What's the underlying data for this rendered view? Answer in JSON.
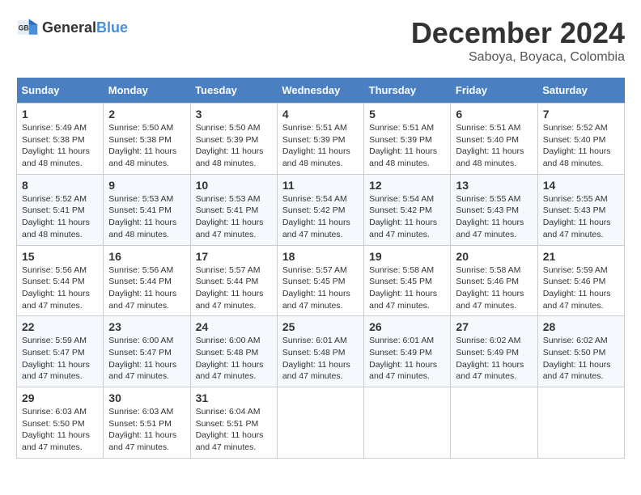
{
  "logo": {
    "text_general": "General",
    "text_blue": "Blue"
  },
  "title": {
    "month": "December 2024",
    "location": "Saboya, Boyaca, Colombia"
  },
  "weekdays": [
    "Sunday",
    "Monday",
    "Tuesday",
    "Wednesday",
    "Thursday",
    "Friday",
    "Saturday"
  ],
  "weeks": [
    [
      {
        "day": "1",
        "info": "Sunrise: 5:49 AM\nSunset: 5:38 PM\nDaylight: 11 hours\nand 48 minutes."
      },
      {
        "day": "2",
        "info": "Sunrise: 5:50 AM\nSunset: 5:38 PM\nDaylight: 11 hours\nand 48 minutes."
      },
      {
        "day": "3",
        "info": "Sunrise: 5:50 AM\nSunset: 5:39 PM\nDaylight: 11 hours\nand 48 minutes."
      },
      {
        "day": "4",
        "info": "Sunrise: 5:51 AM\nSunset: 5:39 PM\nDaylight: 11 hours\nand 48 minutes."
      },
      {
        "day": "5",
        "info": "Sunrise: 5:51 AM\nSunset: 5:39 PM\nDaylight: 11 hours\nand 48 minutes."
      },
      {
        "day": "6",
        "info": "Sunrise: 5:51 AM\nSunset: 5:40 PM\nDaylight: 11 hours\nand 48 minutes."
      },
      {
        "day": "7",
        "info": "Sunrise: 5:52 AM\nSunset: 5:40 PM\nDaylight: 11 hours\nand 48 minutes."
      }
    ],
    [
      {
        "day": "8",
        "info": "Sunrise: 5:52 AM\nSunset: 5:41 PM\nDaylight: 11 hours\nand 48 minutes."
      },
      {
        "day": "9",
        "info": "Sunrise: 5:53 AM\nSunset: 5:41 PM\nDaylight: 11 hours\nand 48 minutes."
      },
      {
        "day": "10",
        "info": "Sunrise: 5:53 AM\nSunset: 5:41 PM\nDaylight: 11 hours\nand 47 minutes."
      },
      {
        "day": "11",
        "info": "Sunrise: 5:54 AM\nSunset: 5:42 PM\nDaylight: 11 hours\nand 47 minutes."
      },
      {
        "day": "12",
        "info": "Sunrise: 5:54 AM\nSunset: 5:42 PM\nDaylight: 11 hours\nand 47 minutes."
      },
      {
        "day": "13",
        "info": "Sunrise: 5:55 AM\nSunset: 5:43 PM\nDaylight: 11 hours\nand 47 minutes."
      },
      {
        "day": "14",
        "info": "Sunrise: 5:55 AM\nSunset: 5:43 PM\nDaylight: 11 hours\nand 47 minutes."
      }
    ],
    [
      {
        "day": "15",
        "info": "Sunrise: 5:56 AM\nSunset: 5:44 PM\nDaylight: 11 hours\nand 47 minutes."
      },
      {
        "day": "16",
        "info": "Sunrise: 5:56 AM\nSunset: 5:44 PM\nDaylight: 11 hours\nand 47 minutes."
      },
      {
        "day": "17",
        "info": "Sunrise: 5:57 AM\nSunset: 5:44 PM\nDaylight: 11 hours\nand 47 minutes."
      },
      {
        "day": "18",
        "info": "Sunrise: 5:57 AM\nSunset: 5:45 PM\nDaylight: 11 hours\nand 47 minutes."
      },
      {
        "day": "19",
        "info": "Sunrise: 5:58 AM\nSunset: 5:45 PM\nDaylight: 11 hours\nand 47 minutes."
      },
      {
        "day": "20",
        "info": "Sunrise: 5:58 AM\nSunset: 5:46 PM\nDaylight: 11 hours\nand 47 minutes."
      },
      {
        "day": "21",
        "info": "Sunrise: 5:59 AM\nSunset: 5:46 PM\nDaylight: 11 hours\nand 47 minutes."
      }
    ],
    [
      {
        "day": "22",
        "info": "Sunrise: 5:59 AM\nSunset: 5:47 PM\nDaylight: 11 hours\nand 47 minutes."
      },
      {
        "day": "23",
        "info": "Sunrise: 6:00 AM\nSunset: 5:47 PM\nDaylight: 11 hours\nand 47 minutes."
      },
      {
        "day": "24",
        "info": "Sunrise: 6:00 AM\nSunset: 5:48 PM\nDaylight: 11 hours\nand 47 minutes."
      },
      {
        "day": "25",
        "info": "Sunrise: 6:01 AM\nSunset: 5:48 PM\nDaylight: 11 hours\nand 47 minutes."
      },
      {
        "day": "26",
        "info": "Sunrise: 6:01 AM\nSunset: 5:49 PM\nDaylight: 11 hours\nand 47 minutes."
      },
      {
        "day": "27",
        "info": "Sunrise: 6:02 AM\nSunset: 5:49 PM\nDaylight: 11 hours\nand 47 minutes."
      },
      {
        "day": "28",
        "info": "Sunrise: 6:02 AM\nSunset: 5:50 PM\nDaylight: 11 hours\nand 47 minutes."
      }
    ],
    [
      {
        "day": "29",
        "info": "Sunrise: 6:03 AM\nSunset: 5:50 PM\nDaylight: 11 hours\nand 47 minutes."
      },
      {
        "day": "30",
        "info": "Sunrise: 6:03 AM\nSunset: 5:51 PM\nDaylight: 11 hours\nand 47 minutes."
      },
      {
        "day": "31",
        "info": "Sunrise: 6:04 AM\nSunset: 5:51 PM\nDaylight: 11 hours\nand 47 minutes."
      },
      null,
      null,
      null,
      null
    ]
  ]
}
